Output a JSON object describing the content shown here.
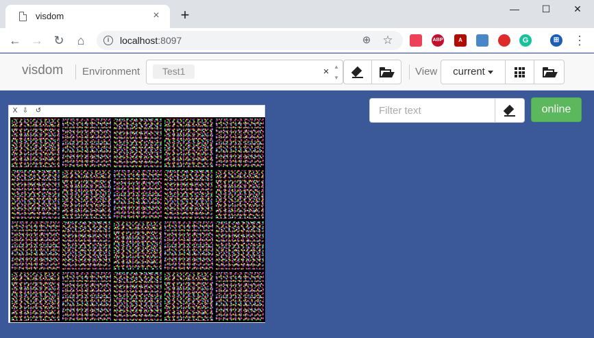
{
  "browser": {
    "tab_title": "visdom",
    "tab_close": "×",
    "new_tab": "+",
    "address_host": "localhost",
    "address_port": ":8097",
    "minimize": "—",
    "maximize": "☐",
    "close": "✕",
    "back": "←",
    "forward": "→",
    "reload": "↻",
    "home": "⌂",
    "zoom": "⊕",
    "star": "☆",
    "extensions": [
      {
        "name": "pocket-icon",
        "label": "",
        "color": "#ef4056"
      },
      {
        "name": "adblock-plus-icon",
        "label": "ABP",
        "color": "#c70d2c"
      },
      {
        "name": "pdf-icon",
        "label": "A",
        "color": "#b30b00"
      },
      {
        "name": "graduation-cap-icon",
        "label": "",
        "color": "#4a87c8"
      },
      {
        "name": "stop-hand-icon",
        "label": "",
        "color": "#e02a2a"
      },
      {
        "name": "grammarly-icon",
        "label": "G",
        "color": "#15c39a"
      },
      {
        "name": "profile-avatar-icon",
        "label": "⊞",
        "color": "#1a5fb4"
      }
    ],
    "menu": "⋮"
  },
  "visdom": {
    "brand": "visdom",
    "environment_label": "Environment",
    "env_tag": "Test1",
    "env_clear": "×",
    "view_label": "View",
    "view_select": "current",
    "filter_placeholder": "Filter text",
    "status": "online"
  },
  "pane": {
    "close_btn": "X",
    "download_btn": "⇩",
    "reset_btn": "↺"
  },
  "colors": {
    "background": "#3b5998",
    "online": "#5cb85c"
  }
}
